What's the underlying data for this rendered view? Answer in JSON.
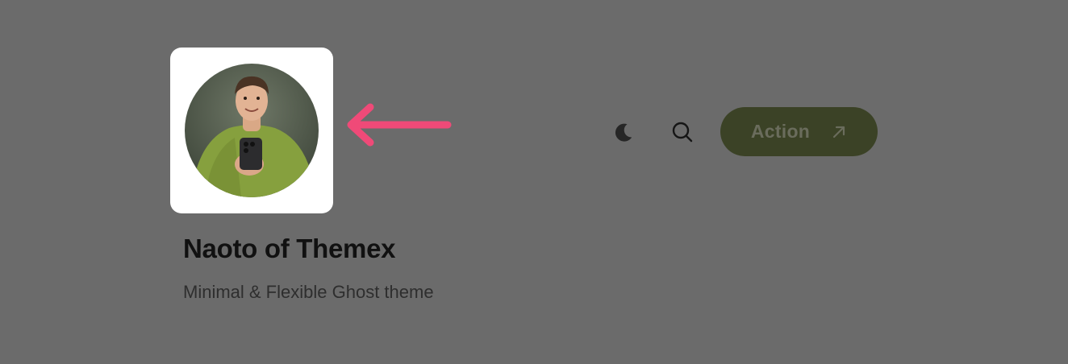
{
  "site": {
    "title": "Naoto of Themex",
    "description": "Minimal & Flexible Ghost theme"
  },
  "header": {
    "action_label": "Action"
  },
  "icons": {
    "theme_toggle": "moon-icon",
    "search": "search-icon",
    "action": "arrow-up-right-icon",
    "pointer": "arrow-left-icon"
  },
  "colors": {
    "page_background": "#6b6b6b",
    "action_button": "#3b4226",
    "pointer_arrow": "#ef4a78"
  }
}
